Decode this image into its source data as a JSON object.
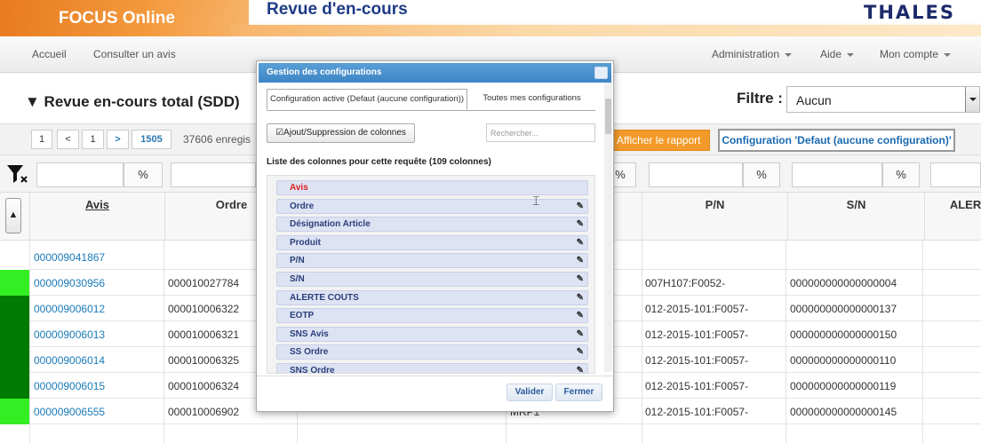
{
  "header": {
    "brand": "FOCUS Online",
    "title": "Revue d'en-cours",
    "logo": "THALES"
  },
  "nav": {
    "home": "Accueil",
    "consult": "Consulter un avis",
    "admin": "Administration",
    "help": "Aide",
    "account": "Mon compte"
  },
  "section": {
    "title": "▼ Revue en-cours total (SDD)",
    "filter_label": "Filtre :",
    "filter_value": "Aucun"
  },
  "pager": {
    "first": "1",
    "prev": "<",
    "current": "1",
    "next": ">",
    "last": "1505",
    "count": "37606 enregis"
  },
  "actions": {
    "report": "Afficher le rapport",
    "config": "Configuration 'Defaut (aucune configuration)'"
  },
  "filters": {
    "pct": "%"
  },
  "columns": {
    "avis": "Avis",
    "ordre": "Ordre",
    "pn": "P/N",
    "sn": "S/N",
    "alert": "ALERT"
  },
  "rows": [
    {
      "avis": "000009041867",
      "ordre": "",
      "pn": "",
      "sn": "",
      "status": "#ffffff",
      "extra": ""
    },
    {
      "avis": "000009030956",
      "ordre": "000010027784",
      "pn": "007H107:F0052-",
      "sn": "000000000000000004",
      "status": "#33ee22",
      "extra": ""
    },
    {
      "avis": "000009006012",
      "ordre": "000010006322",
      "pn": "012-2015-101:F0057-",
      "sn": "000000000000000137",
      "status": "#007a00",
      "extra": ""
    },
    {
      "avis": "000009006013",
      "ordre": "000010006321",
      "pn": "012-2015-101:F0057-",
      "sn": "000000000000000150",
      "status": "#007a00",
      "extra": ""
    },
    {
      "avis": "000009006014",
      "ordre": "000010006325",
      "pn": "012-2015-101:F0057-",
      "sn": "000000000000000110",
      "status": "#007a00",
      "extra": ""
    },
    {
      "avis": "000009006015",
      "ordre": "000010006324",
      "pn": "012-2015-101:F0057-",
      "sn": "000000000000000119",
      "status": "#007a00",
      "extra": ""
    },
    {
      "avis": "000009006555",
      "ordre": "000010006902",
      "pn": "012-2015-101:F0057-",
      "sn": "000000000000000145",
      "status": "#33ee22",
      "extra": "MRP1"
    }
  ],
  "modal": {
    "title": "Gestion des configurations",
    "tab_active": "Configuration active (Defaut (aucune configuration))",
    "tab_other": "Toutes mes configurations",
    "add_button": "Ajout/Suppression de colonnes",
    "search_placeholder": "Rechercher...",
    "list_title": "Liste des colonnes pour cette requête (109 colonnes)",
    "items": [
      "Avis",
      "Ordre",
      "Désignation Article",
      "Produit",
      "P/N",
      "S/N",
      "ALERTE COUTS",
      "EOTP",
      "SNS Avis",
      "SS Ordre",
      "SNS Ordre"
    ],
    "validate": "Valider",
    "close": "Fermer"
  }
}
